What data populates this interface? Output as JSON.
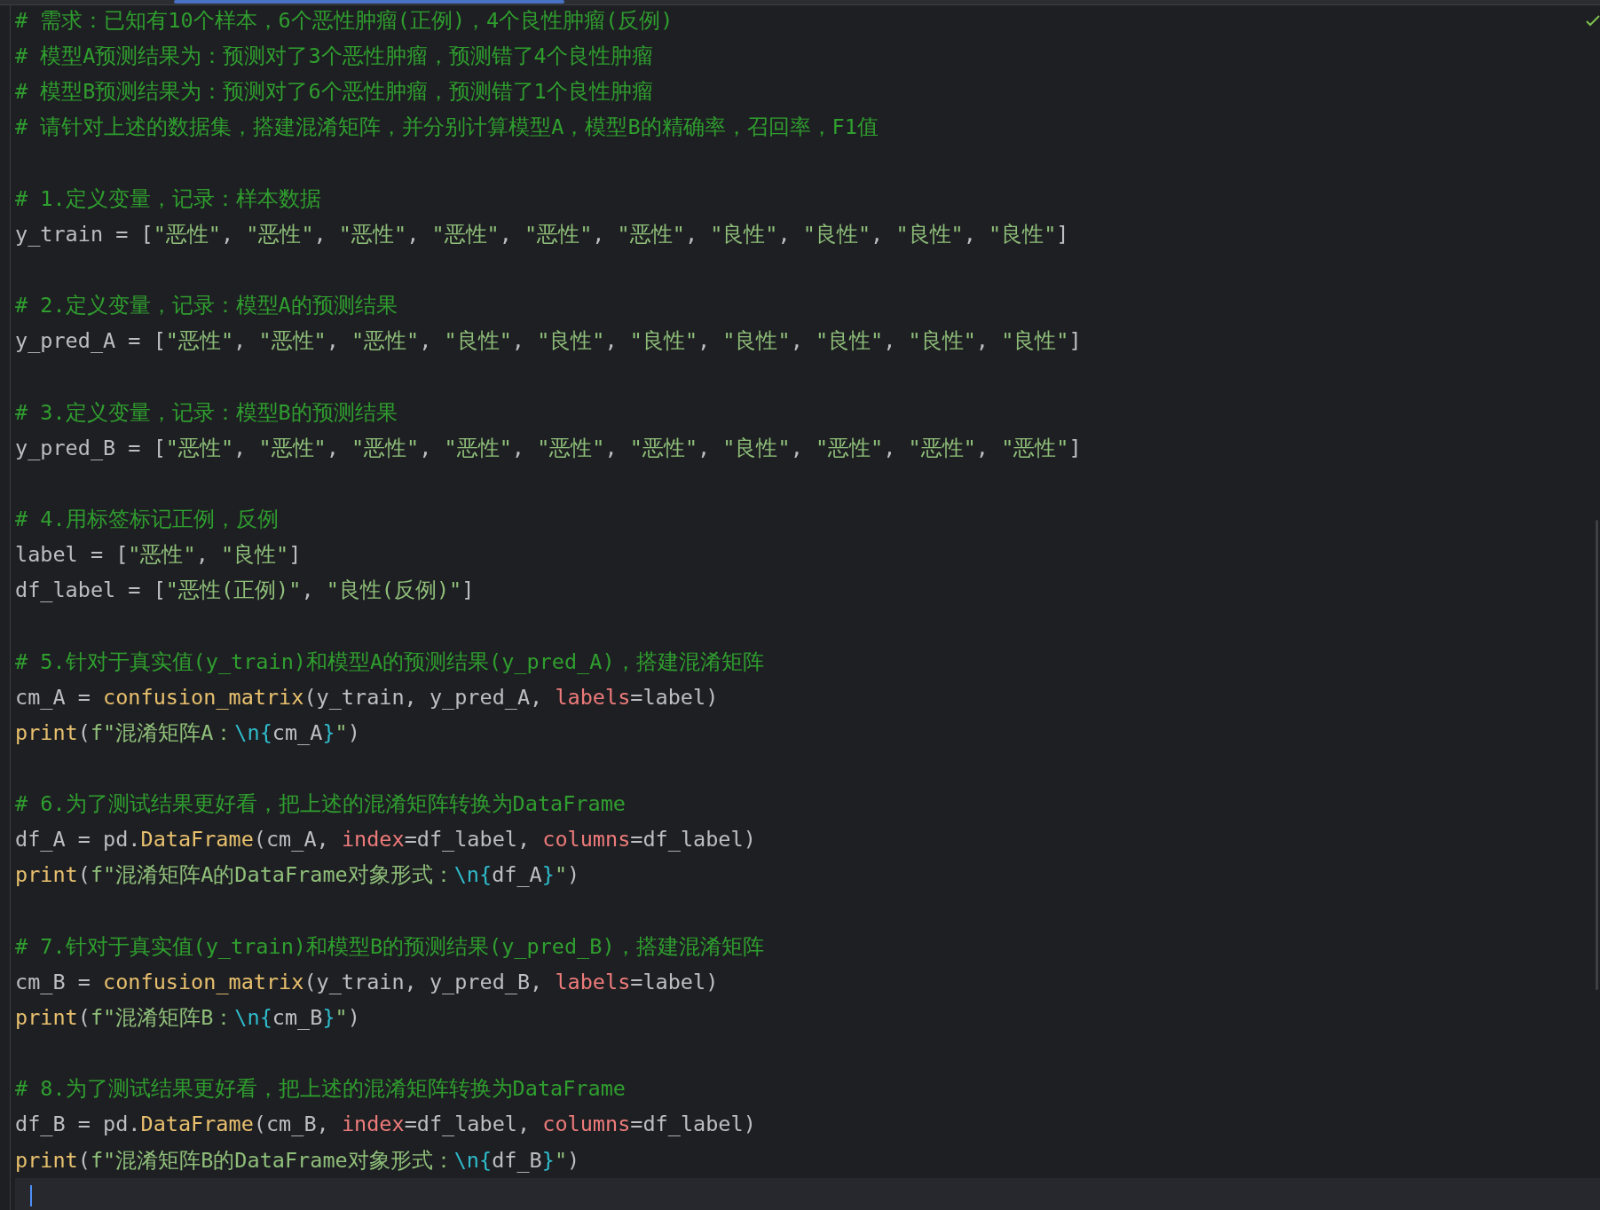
{
  "editor": {
    "lines": [
      {
        "kind": "comment",
        "current": false,
        "tokens": [
          {
            "kind": "comment",
            "text": "# 需求：已知有10个样本，6个恶性肿瘤(正例)，4个良性肿瘤(反例)"
          }
        ]
      },
      {
        "kind": "comment",
        "current": false,
        "tokens": [
          {
            "kind": "comment",
            "text": "# 模型A预测结果为：预测对了3个恶性肿瘤，预测错了4个良性肿瘤"
          }
        ]
      },
      {
        "kind": "comment",
        "current": false,
        "tokens": [
          {
            "kind": "comment",
            "text": "# 模型B预测结果为：预测对了6个恶性肿瘤，预测错了1个良性肿瘤"
          }
        ]
      },
      {
        "kind": "comment",
        "current": false,
        "tokens": [
          {
            "kind": "comment",
            "text": "# 请针对上述的数据集，搭建混淆矩阵，并分别计算模型A，模型B的精确率，召回率，F1值"
          }
        ]
      },
      {
        "kind": "blank",
        "current": false
      },
      {
        "kind": "comment",
        "current": false,
        "tokens": [
          {
            "kind": "comment",
            "text": "# 1.定义变量，记录：样本数据"
          }
        ]
      },
      {
        "kind": "code",
        "current": false,
        "tokens": [
          {
            "kind": "plain",
            "text": "y_train = ["
          },
          {
            "kind": "string",
            "text": "\"恶性\""
          },
          {
            "kind": "plain",
            "text": ", "
          },
          {
            "kind": "string",
            "text": "\"恶性\""
          },
          {
            "kind": "plain",
            "text": ", "
          },
          {
            "kind": "string",
            "text": "\"恶性\""
          },
          {
            "kind": "plain",
            "text": ", "
          },
          {
            "kind": "string",
            "text": "\"恶性\""
          },
          {
            "kind": "plain",
            "text": ", "
          },
          {
            "kind": "string",
            "text": "\"恶性\""
          },
          {
            "kind": "plain",
            "text": ", "
          },
          {
            "kind": "string",
            "text": "\"恶性\""
          },
          {
            "kind": "plain",
            "text": ", "
          },
          {
            "kind": "string",
            "text": "\"良性\""
          },
          {
            "kind": "plain",
            "text": ", "
          },
          {
            "kind": "string",
            "text": "\"良性\""
          },
          {
            "kind": "plain",
            "text": ", "
          },
          {
            "kind": "string",
            "text": "\"良性\""
          },
          {
            "kind": "plain",
            "text": ", "
          },
          {
            "kind": "string",
            "text": "\"良性\""
          },
          {
            "kind": "plain",
            "text": "]"
          }
        ]
      },
      {
        "kind": "blank",
        "current": false
      },
      {
        "kind": "comment",
        "current": false,
        "tokens": [
          {
            "kind": "comment",
            "text": "# 2.定义变量，记录：模型A的预测结果"
          }
        ]
      },
      {
        "kind": "code",
        "current": false,
        "tokens": [
          {
            "kind": "plain",
            "text": "y_pred_A = ["
          },
          {
            "kind": "string",
            "text": "\"恶性\""
          },
          {
            "kind": "plain",
            "text": ", "
          },
          {
            "kind": "string",
            "text": "\"恶性\""
          },
          {
            "kind": "plain",
            "text": ", "
          },
          {
            "kind": "string",
            "text": "\"恶性\""
          },
          {
            "kind": "plain",
            "text": ", "
          },
          {
            "kind": "string",
            "text": "\"良性\""
          },
          {
            "kind": "plain",
            "text": ", "
          },
          {
            "kind": "string",
            "text": "\"良性\""
          },
          {
            "kind": "plain",
            "text": ", "
          },
          {
            "kind": "string",
            "text": "\"良性\""
          },
          {
            "kind": "plain",
            "text": ", "
          },
          {
            "kind": "string",
            "text": "\"良性\""
          },
          {
            "kind": "plain",
            "text": ", "
          },
          {
            "kind": "string",
            "text": "\"良性\""
          },
          {
            "kind": "plain",
            "text": ", "
          },
          {
            "kind": "string",
            "text": "\"良性\""
          },
          {
            "kind": "plain",
            "text": ", "
          },
          {
            "kind": "string",
            "text": "\"良性\""
          },
          {
            "kind": "plain",
            "text": "]"
          }
        ]
      },
      {
        "kind": "blank",
        "current": false
      },
      {
        "kind": "comment",
        "current": false,
        "tokens": [
          {
            "kind": "comment",
            "text": "# 3.定义变量，记录：模型B的预测结果"
          }
        ]
      },
      {
        "kind": "code",
        "current": false,
        "tokens": [
          {
            "kind": "plain",
            "text": "y_pred_B = ["
          },
          {
            "kind": "string",
            "text": "\"恶性\""
          },
          {
            "kind": "plain",
            "text": ", "
          },
          {
            "kind": "string",
            "text": "\"恶性\""
          },
          {
            "kind": "plain",
            "text": ", "
          },
          {
            "kind": "string",
            "text": "\"恶性\""
          },
          {
            "kind": "plain",
            "text": ", "
          },
          {
            "kind": "string",
            "text": "\"恶性\""
          },
          {
            "kind": "plain",
            "text": ", "
          },
          {
            "kind": "string",
            "text": "\"恶性\""
          },
          {
            "kind": "plain",
            "text": ", "
          },
          {
            "kind": "string",
            "text": "\"恶性\""
          },
          {
            "kind": "plain",
            "text": ", "
          },
          {
            "kind": "string",
            "text": "\"良性\""
          },
          {
            "kind": "plain",
            "text": ", "
          },
          {
            "kind": "string",
            "text": "\"恶性\""
          },
          {
            "kind": "plain",
            "text": ", "
          },
          {
            "kind": "string",
            "text": "\"恶性\""
          },
          {
            "kind": "plain",
            "text": ", "
          },
          {
            "kind": "string",
            "text": "\"恶性\""
          },
          {
            "kind": "plain",
            "text": "]"
          }
        ]
      },
      {
        "kind": "blank",
        "current": false
      },
      {
        "kind": "comment",
        "current": false,
        "tokens": [
          {
            "kind": "comment",
            "text": "# 4.用标签标记正例，反例"
          }
        ]
      },
      {
        "kind": "code",
        "current": false,
        "tokens": [
          {
            "kind": "plain",
            "text": "label = ["
          },
          {
            "kind": "string",
            "text": "\"恶性\""
          },
          {
            "kind": "plain",
            "text": ", "
          },
          {
            "kind": "string",
            "text": "\"良性\""
          },
          {
            "kind": "plain",
            "text": "]"
          }
        ]
      },
      {
        "kind": "code",
        "current": false,
        "tokens": [
          {
            "kind": "plain",
            "text": "df_label = ["
          },
          {
            "kind": "string",
            "text": "\"恶性(正例)\""
          },
          {
            "kind": "plain",
            "text": ", "
          },
          {
            "kind": "string",
            "text": "\"良性(反例)\""
          },
          {
            "kind": "plain",
            "text": "]"
          }
        ]
      },
      {
        "kind": "blank",
        "current": false
      },
      {
        "kind": "comment",
        "current": false,
        "tokens": [
          {
            "kind": "comment",
            "text": "# 5.针对于真实值(y_train)和模型A的预测结果(y_pred_A)，搭建混淆矩阵"
          }
        ]
      },
      {
        "kind": "code",
        "current": false,
        "tokens": [
          {
            "kind": "plain",
            "text": "cm_A = "
          },
          {
            "kind": "func",
            "text": "confusion_matrix"
          },
          {
            "kind": "plain",
            "text": "(y_train, y_pred_A, "
          },
          {
            "kind": "kwarg",
            "text": "labels"
          },
          {
            "kind": "plain",
            "text": "=label)"
          }
        ]
      },
      {
        "kind": "code",
        "current": false,
        "tokens": [
          {
            "kind": "func",
            "text": "print"
          },
          {
            "kind": "plain",
            "text": "("
          },
          {
            "kind": "string",
            "text": "f\"混淆矩阵A："
          },
          {
            "kind": "escape",
            "text": "\\n{"
          },
          {
            "kind": "plain",
            "text": "cm_A"
          },
          {
            "kind": "escape",
            "text": "}"
          },
          {
            "kind": "string",
            "text": "\""
          },
          {
            "kind": "plain",
            "text": ")"
          }
        ]
      },
      {
        "kind": "blank",
        "current": false
      },
      {
        "kind": "comment",
        "current": false,
        "tokens": [
          {
            "kind": "comment",
            "text": "# 6.为了测试结果更好看，把上述的混淆矩阵转换为DataFrame"
          }
        ]
      },
      {
        "kind": "code",
        "current": false,
        "tokens": [
          {
            "kind": "plain",
            "text": "df_A = pd."
          },
          {
            "kind": "func",
            "text": "DataFrame"
          },
          {
            "kind": "plain",
            "text": "(cm_A, "
          },
          {
            "kind": "kwarg",
            "text": "index"
          },
          {
            "kind": "plain",
            "text": "=df_label, "
          },
          {
            "kind": "kwarg",
            "text": "columns"
          },
          {
            "kind": "plain",
            "text": "=df_label)"
          }
        ]
      },
      {
        "kind": "code",
        "current": false,
        "tokens": [
          {
            "kind": "func",
            "text": "print"
          },
          {
            "kind": "plain",
            "text": "("
          },
          {
            "kind": "string",
            "text": "f\"混淆矩阵A的DataFrame对象形式："
          },
          {
            "kind": "escape",
            "text": "\\n{"
          },
          {
            "kind": "plain",
            "text": "df_A"
          },
          {
            "kind": "escape",
            "text": "}"
          },
          {
            "kind": "string",
            "text": "\""
          },
          {
            "kind": "plain",
            "text": ")"
          }
        ]
      },
      {
        "kind": "blank",
        "current": false
      },
      {
        "kind": "comment",
        "current": false,
        "tokens": [
          {
            "kind": "comment",
            "text": "# 7.针对于真实值(y_train)和模型B的预测结果(y_pred_B)，搭建混淆矩阵"
          }
        ]
      },
      {
        "kind": "code",
        "current": false,
        "tokens": [
          {
            "kind": "plain",
            "text": "cm_B = "
          },
          {
            "kind": "func",
            "text": "confusion_matrix"
          },
          {
            "kind": "plain",
            "text": "(y_train, y_pred_B, "
          },
          {
            "kind": "kwarg",
            "text": "labels"
          },
          {
            "kind": "plain",
            "text": "=label)"
          }
        ]
      },
      {
        "kind": "code",
        "current": false,
        "tokens": [
          {
            "kind": "func",
            "text": "print"
          },
          {
            "kind": "plain",
            "text": "("
          },
          {
            "kind": "string",
            "text": "f\"混淆矩阵B："
          },
          {
            "kind": "escape",
            "text": "\\n{"
          },
          {
            "kind": "plain",
            "text": "cm_B"
          },
          {
            "kind": "escape",
            "text": "}"
          },
          {
            "kind": "string",
            "text": "\""
          },
          {
            "kind": "plain",
            "text": ")"
          }
        ]
      },
      {
        "kind": "blank",
        "current": false
      },
      {
        "kind": "comment",
        "current": false,
        "tokens": [
          {
            "kind": "comment",
            "text": "# 8.为了测试结果更好看，把上述的混淆矩阵转换为DataFrame"
          }
        ]
      },
      {
        "kind": "code",
        "current": false,
        "tokens": [
          {
            "kind": "plain",
            "text": "df_B = pd."
          },
          {
            "kind": "func",
            "text": "DataFrame"
          },
          {
            "kind": "plain",
            "text": "(cm_B, "
          },
          {
            "kind": "kwarg",
            "text": "index"
          },
          {
            "kind": "plain",
            "text": "=df_label, "
          },
          {
            "kind": "kwarg",
            "text": "columns"
          },
          {
            "kind": "plain",
            "text": "=df_label)"
          }
        ]
      },
      {
        "kind": "code",
        "current": false,
        "tokens": [
          {
            "kind": "func",
            "text": "print"
          },
          {
            "kind": "plain",
            "text": "("
          },
          {
            "kind": "string",
            "text": "f\"混淆矩阵B的DataFrame对象形式："
          },
          {
            "kind": "escape",
            "text": "\\n{"
          },
          {
            "kind": "plain",
            "text": "df_B"
          },
          {
            "kind": "escape",
            "text": "}"
          },
          {
            "kind": "string",
            "text": "\""
          },
          {
            "kind": "plain",
            "text": ")"
          }
        ]
      },
      {
        "kind": "blank",
        "current": true
      }
    ]
  }
}
